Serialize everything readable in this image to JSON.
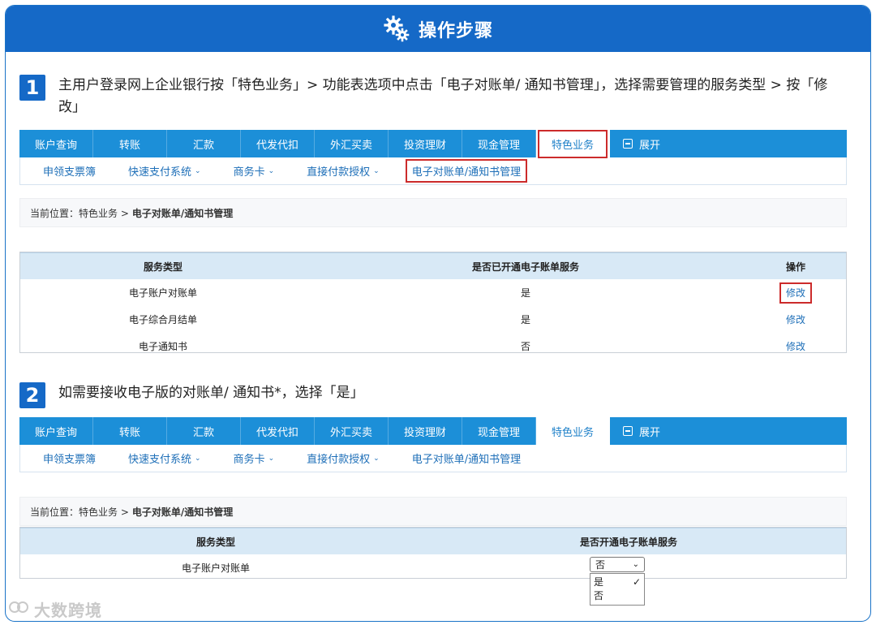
{
  "header": {
    "title": "操作步骤",
    "icon": "gears-icon"
  },
  "steps": [
    {
      "num": "1",
      "text": "主用户登录网上企业银行按「特色业务」> 功能表选项中点击「电子对账单/ 通知书管理」，选择需要管理的服务类型 > 按「修改」"
    },
    {
      "num": "2",
      "text": "如需要接收电子版的对账单/ 通知书*，选择「是」"
    }
  ],
  "nav": {
    "items": [
      "账户查询",
      "转账",
      "汇款",
      "代发代扣",
      "外汇买卖",
      "投资理财",
      "现金管理",
      "特色业务"
    ],
    "expand": "展开"
  },
  "subnav": {
    "items": [
      "申领支票簿",
      "快速支付系统",
      "商务卡",
      "直接付款授权",
      "电子对账单/通知书管理"
    ]
  },
  "breadcrumb": {
    "prefix": "当前位置：特色业务 >",
    "current": "电子对账单/通知书管理"
  },
  "table1": {
    "headers": [
      "服务类型",
      "是否已开通电子账单服务",
      "操作"
    ],
    "rows": [
      {
        "type": "电子账户对账单",
        "status": "是",
        "action": "修改"
      },
      {
        "type": "电子综合月结单",
        "status": "是",
        "action": "修改"
      },
      {
        "type": "电子通知书",
        "status": "否",
        "action": "修改"
      }
    ]
  },
  "table2": {
    "headers": [
      "服务类型",
      "是否开通电子账单服务"
    ],
    "rows": [
      {
        "type": "电子账户对账单",
        "selected": "否"
      }
    ],
    "options": [
      "是",
      "否"
    ]
  },
  "watermark": "大数跨境",
  "colors": {
    "header": "#1569c7",
    "nav": "#1c8fd8",
    "highlight": "#cc2b2b",
    "link": "#1e6fb8"
  }
}
